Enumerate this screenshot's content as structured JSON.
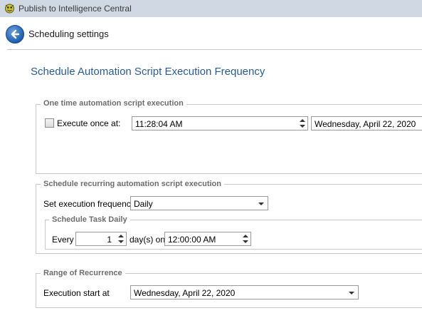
{
  "window": {
    "title": "Publish to Intelligence Central",
    "app_icon": "dragon-icon"
  },
  "header": {
    "back_icon": "back-arrow-icon",
    "label": "Scheduling settings"
  },
  "page_title": "Schedule Automation Script Execution Frequency",
  "one_time": {
    "legend": "One time automation script execution",
    "checkbox_label": "Execute once at:",
    "checked": false,
    "time": "11:28:04 AM",
    "date": "Wednesday, April 22, 2020"
  },
  "recurring": {
    "legend": "Schedule recurring automation script execution",
    "frequency_label": "Set execution frequency",
    "frequency_value": "Daily",
    "daily": {
      "legend": "Schedule Task Daily",
      "every_label": "Every",
      "every_value": "1",
      "days_on_label": "day(s) on",
      "time": "12:00:00 AM"
    }
  },
  "range": {
    "legend": "Range of Recurrence",
    "start_label": "Execution start at",
    "start_value": "Wednesday, April 22, 2020"
  },
  "colors": {
    "titlebar": "#cfd8e3",
    "title_blue": "#2a5b8e",
    "legend_gray": "#6d6d6d"
  }
}
